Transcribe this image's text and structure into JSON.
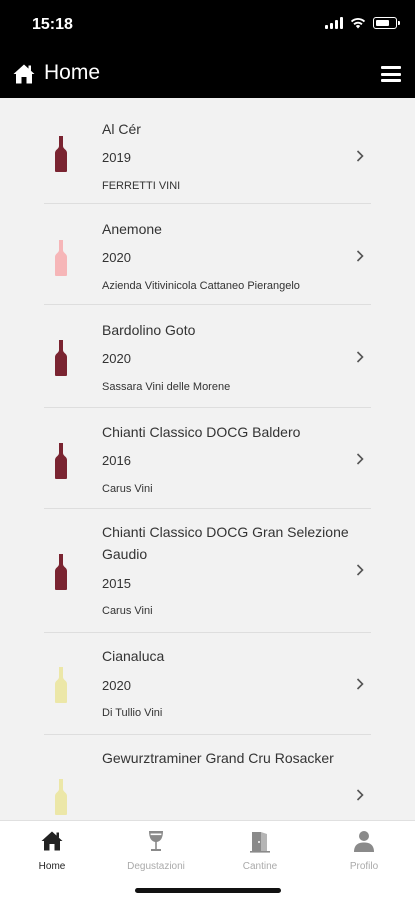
{
  "status": {
    "time": "15:18"
  },
  "header": {
    "title": "Home",
    "home_icon": "home-icon",
    "menu_icon": "hamburger-menu-icon"
  },
  "wines": [
    {
      "name": "Al Cér",
      "year": "2019",
      "producer": "FERRETTI VINI",
      "color": "#7a2431"
    },
    {
      "name": "Anemone",
      "year": "2020",
      "producer": "Azienda Vitivinicola Cattaneo Pierangelo",
      "color": "#f6b6b8"
    },
    {
      "name": "Bardolino Goto",
      "year": "2020",
      "producer": "Sassara Vini delle Morene",
      "color": "#7a2431"
    },
    {
      "name": "Chianti Classico DOCG Baldero",
      "year": "2016",
      "producer": "Carus Vini",
      "color": "#7a2431"
    },
    {
      "name": "Chianti Classico DOCG Gran Selezione Gaudio",
      "year": "2015",
      "producer": "Carus Vini",
      "color": "#7a2431"
    },
    {
      "name": "Cianaluca",
      "year": "2020",
      "producer": "Di Tullio Vini",
      "color": "#ece7a8"
    },
    {
      "name": "Gewurztraminer Grand Cru Rosacker",
      "year": "",
      "producer": "",
      "color": "#ece7a8"
    }
  ],
  "tabs": [
    {
      "label": "Home",
      "icon": "home-icon",
      "active": true
    },
    {
      "label": "Degustazioni",
      "icon": "wine-glass-icon",
      "active": false
    },
    {
      "label": "Cantine",
      "icon": "cellar-door-icon",
      "active": false
    },
    {
      "label": "Profilo",
      "icon": "user-icon",
      "active": false
    }
  ]
}
